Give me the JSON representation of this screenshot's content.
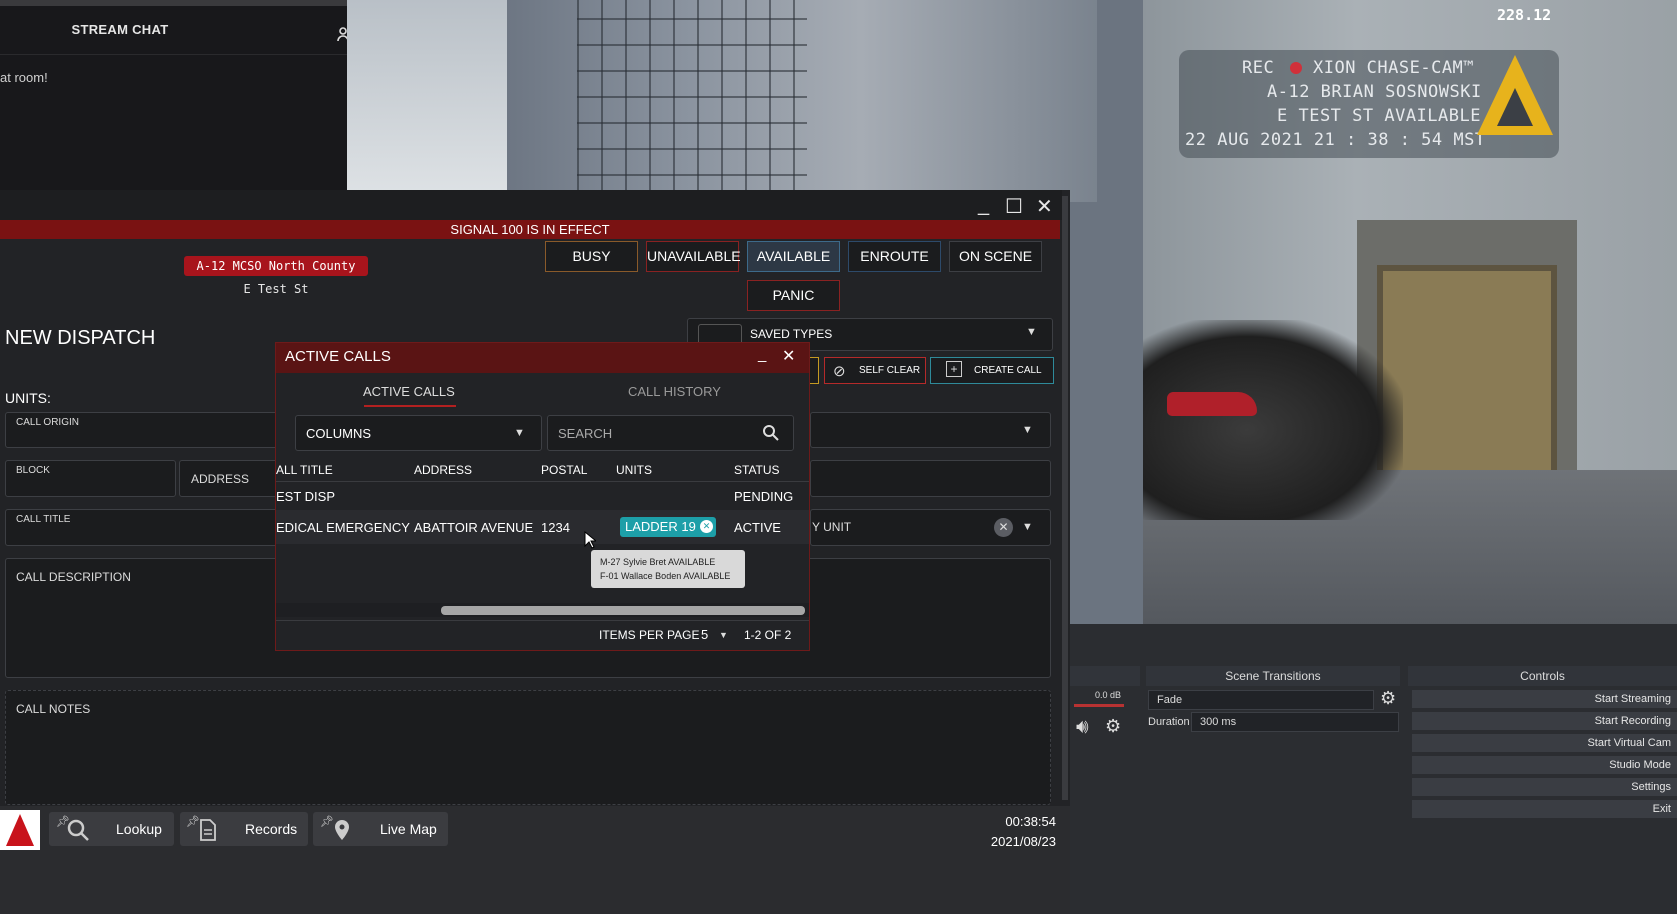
{
  "stream_chat": {
    "title": "STREAM CHAT",
    "message": "at room!"
  },
  "overlay": {
    "fps": "228.12",
    "rec_line1": "REC  ●  XION CHASE-CAM™",
    "rec_label": "REC",
    "cam_name": "XION CHASE-CAM™",
    "officer": "A-12 BRIAN SOSNOWSKI",
    "status": "E TEST ST AVAILABLE",
    "timestamp": "22 AUG 2021  21 : 38 : 54 MST"
  },
  "window": {
    "min": "_",
    "max": "☐",
    "close": "✕"
  },
  "signal_banner": "SIGNAL 100 IS IN EFFECT",
  "unit": {
    "badge": "A-12 MCSO North County",
    "location": "E Test St"
  },
  "status_buttons": [
    "BUSY",
    "UNAVAILABLE",
    "AVAILABLE",
    "ENROUTE",
    "ON SCENE"
  ],
  "panic": "PANIC",
  "dispatch": {
    "title": "NEW DISPATCH",
    "units_label": "UNITS:",
    "call_origin": "CALL ORIGIN",
    "block": "BLOCK",
    "address": "ADDRESS",
    "call_title": "CALL TITLE",
    "call_description": "CALL DESCRIPTION",
    "call_notes": "CALL NOTES",
    "saved_types": "SAVED TYPES",
    "self_clear": "SELF CLEAR",
    "create_call": "CREATE CALL",
    "unit_select": "Y UNIT"
  },
  "active_calls": {
    "title": "ACTIVE CALLS",
    "tabs": [
      "ACTIVE CALLS",
      "CALL HISTORY"
    ],
    "columns_label": "COLUMNS",
    "search_placeholder": "SEARCH",
    "headers": [
      "ALL TITLE",
      "ADDRESS",
      "POSTAL",
      "UNITS",
      "STATUS"
    ],
    "rows": [
      {
        "title": "EST DISP",
        "address": "",
        "postal": "",
        "units": "",
        "status": "PENDING"
      },
      {
        "title": "EDICAL EMERGENCY",
        "address": "ABATTOIR AVENUE",
        "postal": "1234",
        "units": "LADDER 19",
        "status": "ACTIVE"
      }
    ],
    "tooltip": [
      "M-27 Sylvie Bret AVAILABLE",
      "F-01 Wallace Boden AVAILABLE"
    ],
    "items_per_page_label": "ITEMS PER PAGE",
    "items_per_page": "5",
    "range": "1-2 OF 2"
  },
  "obs": {
    "scene_transitions": "Scene Transitions",
    "controls": "Controls",
    "transition": "Fade",
    "duration_label": "Duration",
    "duration": "300 ms",
    "db": "0.0 dB",
    "buttons": [
      "Start Streaming",
      "Start Recording",
      "Start Virtual Cam",
      "Studio Mode",
      "Settings",
      "Exit"
    ]
  },
  "taskbar": {
    "items": [
      "Lookup",
      "Records",
      "Live Map"
    ],
    "time": "00:38:54",
    "date": "2021/08/23"
  }
}
